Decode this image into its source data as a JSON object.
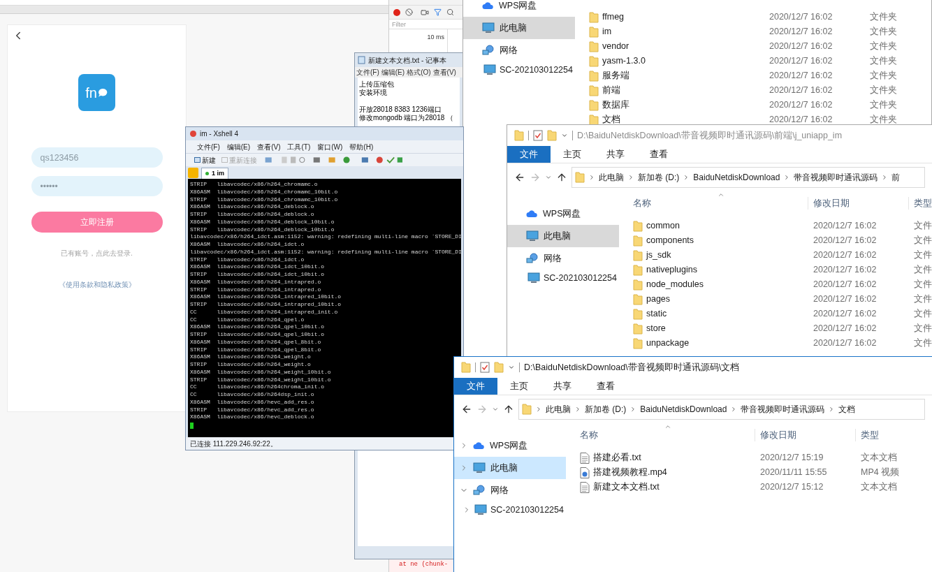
{
  "browser": {
    "phone": {
      "logo": "fn",
      "username": {
        "value": "qs123456"
      },
      "password": {
        "value": "••••••"
      },
      "submit": "立即注册",
      "login_hint": "已有账号，点此去登录.",
      "terms_link": "《使用条款和隐私政策》"
    },
    "devtools": {
      "filter": {
        "placeholder": "Filter"
      },
      "timeline_label": "10 ms",
      "console_line": "at ne (chunk-"
    }
  },
  "notepad": {
    "title": "新建文本文档.txt - 记事本",
    "menu": [
      "文件(F)",
      "编辑(E)",
      "格式(O)",
      "查看(V)"
    ],
    "paragraphs": [
      [
        "上传压缩包",
        "安装环境"
      ],
      [
        "开放28018 8383 1236端口",
        "修改mongodb 端口为28018 （"
      ]
    ]
  },
  "explorer_back": {
    "active": false,
    "sidebar": [
      {
        "label": "WPS网盘",
        "kind": "cloud",
        "selected": false
      },
      {
        "label": "此电脑",
        "kind": "computer",
        "selected": true
      },
      {
        "label": "网络",
        "kind": "network",
        "selected": false,
        "children": [
          {
            "label": "SC-202103012254",
            "kind": "computer",
            "selected": false
          }
        ]
      }
    ],
    "files": [
      {
        "name": "ffmeg",
        "kind": "folder",
        "date": "2020/12/7 16:02",
        "type": "文件夹"
      },
      {
        "name": "im",
        "kind": "folder",
        "date": "2020/12/7 16:02",
        "type": "文件夹"
      },
      {
        "name": "vendor",
        "kind": "folder",
        "date": "2020/12/7 16:02",
        "type": "文件夹"
      },
      {
        "name": "yasm-1.3.0",
        "kind": "folder",
        "date": "2020/12/7 16:02",
        "type": "文件夹"
      },
      {
        "name": "服务端",
        "kind": "folder",
        "date": "2020/12/7 16:02",
        "type": "文件夹"
      },
      {
        "name": "前端",
        "kind": "folder",
        "date": "2020/12/7 16:02",
        "type": "文件夹"
      },
      {
        "name": "数据库",
        "kind": "folder",
        "date": "2020/12/7 16:02",
        "type": "文件夹"
      },
      {
        "name": "文档",
        "kind": "folder",
        "date": "2020/12/7 16:02",
        "type": "文件夹"
      }
    ]
  },
  "xshell": {
    "title": "im - Xshell 4",
    "menu": [
      "文件(F)",
      "编辑(E)",
      "查看(V)",
      "工具(T)",
      "窗口(W)",
      "帮助(H)"
    ],
    "toolbar": [
      {
        "label": "新建",
        "disabled": false
      },
      {
        "label": "重新连接",
        "disabled": true
      }
    ],
    "tabs": [
      {
        "label": "1 im",
        "selected": true
      }
    ],
    "lines": [
      "STRIP   libavcodec/x86/h264_chromamc.o",
      "X86ASM  libavcodec/x86/h264_chromamc_10bit.o",
      "STRIP   libavcodec/x86/h264_chromamc_10bit.o",
      "X86ASM  libavcodec/x86/h264_deblock.o",
      "STRIP   libavcodec/x86/h264_deblock.o",
      "X86ASM  libavcodec/x86/h264_deblock_10bit.o",
      "STRIP   libavcodec/x86/h264_deblock_10bit.o",
      "libavcodec/x86/h264_idct.asm:1152: warning: redefining multi-line macro `STORE_DI",
      "X86ASM  libavcodec/x86/h264_idct.o",
      "libavcodec/x86/h264_idct.asm:1152: warning: redefining multi-line macro `STORE_DI",
      "STRIP   libavcodec/x86/h264_idct.o",
      "X86ASM  libavcodec/x86/h264_idct_10bit.o",
      "STRIP   libavcodec/x86/h264_idct_10bit.o",
      "X86ASM  libavcodec/x86/h264_intrapred.o",
      "STRIP   libavcodec/x86/h264_intrapred.o",
      "X86ASM  libavcodec/x86/h264_intrapred_10bit.o",
      "STRIP   libavcodec/x86/h264_intrapred_10bit.o",
      "CC      libavcodec/x86/h264_intrapred_init.o",
      "CC      libavcodec/x86/h264_qpel.o",
      "X86ASM  libavcodec/x86/h264_qpel_10bit.o",
      "STRIP   libavcodec/x86/h264_qpel_10bit.o",
      "X86ASM  libavcodec/x86/h264_qpel_8bit.o",
      "STRIP   libavcodec/x86/h264_qpel_8bit.o",
      "X86ASM  libavcodec/x86/h264_weight.o",
      "STRIP   libavcodec/x86/h264_weight.o",
      "X86ASM  libavcodec/x86/h264_weight_10bit.o",
      "STRIP   libavcodec/x86/h264_weight_10bit.o",
      "CC      libavcodec/x86/h264chroma_init.o",
      "CC      libavcodec/x86/h264dsp_init.o",
      "X86ASM  libavcodec/x86/hevc_add_res.o",
      "STRIP   libavcodec/x86/hevc_add_res.o",
      "X86ASM  libavcodec/x86/hevc_deblock.o"
    ],
    "status": "已连接 111.229.246.92:22。"
  },
  "explorer_front": {
    "active": false,
    "title": "D:\\BaiduNetdiskDownload\\带音视频即时通讯源码\\前端\\j_uniapp_im",
    "ribbon_tabs": [
      {
        "label": "文件",
        "selected": true
      },
      {
        "label": "主页",
        "selected": false
      },
      {
        "label": "共享",
        "selected": false
      },
      {
        "label": "查看",
        "selected": false
      }
    ],
    "breadcrumb": [
      "此电脑",
      "新加卷 (D:)",
      "BaiduNetdiskDownload",
      "带音视频即时通讯源码",
      "前"
    ],
    "columns": [
      "名称",
      "修改日期",
      "类型"
    ],
    "sidebar": [
      {
        "label": "WPS网盘",
        "kind": "cloud",
        "selected": false
      },
      {
        "label": "此电脑",
        "kind": "computer",
        "selected": true
      },
      {
        "label": "网络",
        "kind": "network",
        "selected": false,
        "children": [
          {
            "label": "SC-202103012254",
            "kind": "computer",
            "selected": false
          }
        ]
      }
    ],
    "files": [
      {
        "name": "common",
        "kind": "folder",
        "date": "2020/12/7 16:02",
        "type": "文件"
      },
      {
        "name": "components",
        "kind": "folder",
        "date": "2020/12/7 16:02",
        "type": "文件"
      },
      {
        "name": "js_sdk",
        "kind": "folder",
        "date": "2020/12/7 16:02",
        "type": "文件"
      },
      {
        "name": "nativeplugins",
        "kind": "folder",
        "date": "2020/12/7 16:02",
        "type": "文件"
      },
      {
        "name": "node_modules",
        "kind": "folder",
        "date": "2020/12/7 16:02",
        "type": "文件"
      },
      {
        "name": "pages",
        "kind": "folder",
        "date": "2020/12/7 16:02",
        "type": "文件"
      },
      {
        "name": "static",
        "kind": "folder",
        "date": "2020/12/7 16:02",
        "type": "文件"
      },
      {
        "name": "store",
        "kind": "folder",
        "date": "2020/12/7 16:02",
        "type": "文件"
      },
      {
        "name": "unpackage",
        "kind": "folder",
        "date": "2020/12/7 16:02",
        "type": "文件"
      }
    ]
  },
  "explorer_docs": {
    "active": true,
    "title": "D:\\BaiduNetdiskDownload\\带音视频即时通讯源码\\文档",
    "ribbon_tabs": [
      {
        "label": "文件",
        "selected": true
      },
      {
        "label": "主页",
        "selected": false
      },
      {
        "label": "共享",
        "selected": false
      },
      {
        "label": "查看",
        "selected": false
      }
    ],
    "breadcrumb": [
      "此电脑",
      "新加卷 (D:)",
      "BaiduNetdiskDownload",
      "带音视频即时通讯源码",
      "文档"
    ],
    "columns": [
      "名称",
      "修改日期",
      "类型"
    ],
    "sidebar": [
      {
        "label": "WPS网盘",
        "kind": "cloud",
        "selected": false,
        "expanded": false
      },
      {
        "label": "此电脑",
        "kind": "computer",
        "selected": true,
        "expanded": false
      },
      {
        "label": "网络",
        "kind": "network",
        "selected": false,
        "expanded": true,
        "children": [
          {
            "label": "SC-202103012254",
            "kind": "computer",
            "selected": false,
            "expanded": false
          }
        ]
      }
    ],
    "files": [
      {
        "name": "搭建必看.txt",
        "kind": "text",
        "date": "2020/12/7 15:19",
        "type": "文本文档"
      },
      {
        "name": "搭建视频教程.mp4",
        "kind": "video",
        "date": "2020/11/11 15:55",
        "type": "MP4 视频"
      },
      {
        "name": "新建文本文档.txt",
        "kind": "text",
        "date": "2020/12/7 15:12",
        "type": "文本文档"
      }
    ]
  }
}
